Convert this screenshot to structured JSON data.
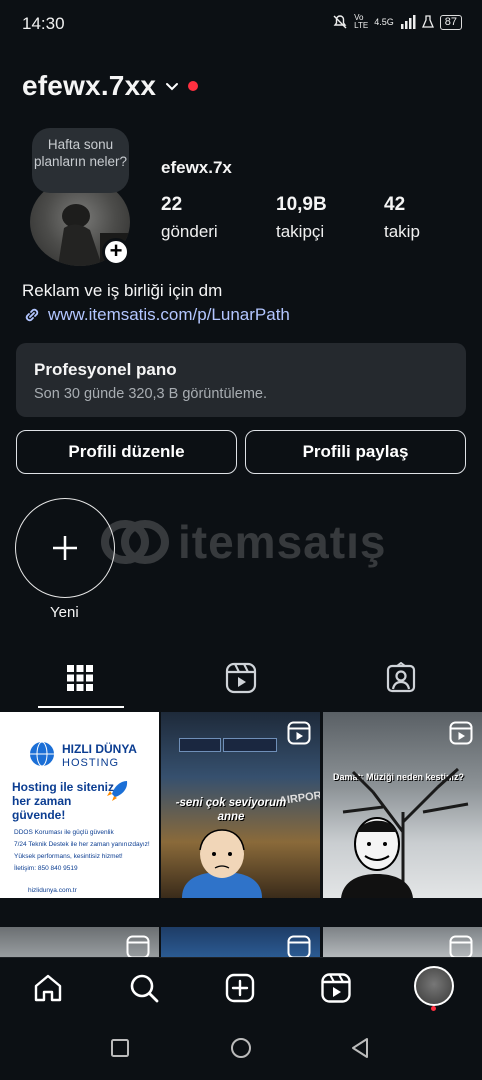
{
  "status_bar": {
    "time": "14:30",
    "network": "4.5G",
    "battery": "87"
  },
  "header": {
    "username": "efewx.7xx"
  },
  "profile": {
    "note": "Hafta sonu planların neler?",
    "display_name": "efewx.7x",
    "stats": [
      {
        "value": "22",
        "label": "gönderi"
      },
      {
        "value": "10,9B",
        "label": "takipçi"
      },
      {
        "value": "42",
        "label": "takip"
      }
    ],
    "bio": "Reklam ve iş birliği için dm",
    "link": "www.itemsatis.com/p/LunarPath"
  },
  "dashboard": {
    "title": "Profesyonel pano",
    "subtitle": "Son 30 günde 320,3 B görüntüleme."
  },
  "buttons": {
    "edit": "Profili düzenle",
    "share": "Profili paylaş"
  },
  "highlights": {
    "new_label": "Yeni"
  },
  "watermark": {
    "text": "itemsatış"
  },
  "posts": [
    {
      "title1": "HIZLI DÜNYA",
      "title2": "HOSTING",
      "headline": "Hosting ile siteniz her zaman güvende!",
      "features": [
        "DDOS Koruması ile güçlü güvenlik",
        "7/24 Teknik Destek ile her zaman yanınızdayız!",
        "Yüksek performans, kesintisiz hizmet!",
        "İletişim: 850 840 9519"
      ],
      "footer": "hizlidunya.com.tr"
    },
    {
      "caption": "-seni çok seviyorum anne",
      "sign": "AIRPORT"
    },
    {
      "caption": "Damat: Müziği neden kestiniz?"
    }
  ],
  "colors": {
    "background": "#0c1014",
    "card": "#25292e",
    "link": "#b3c6ff",
    "accent_red": "#ff3040"
  }
}
